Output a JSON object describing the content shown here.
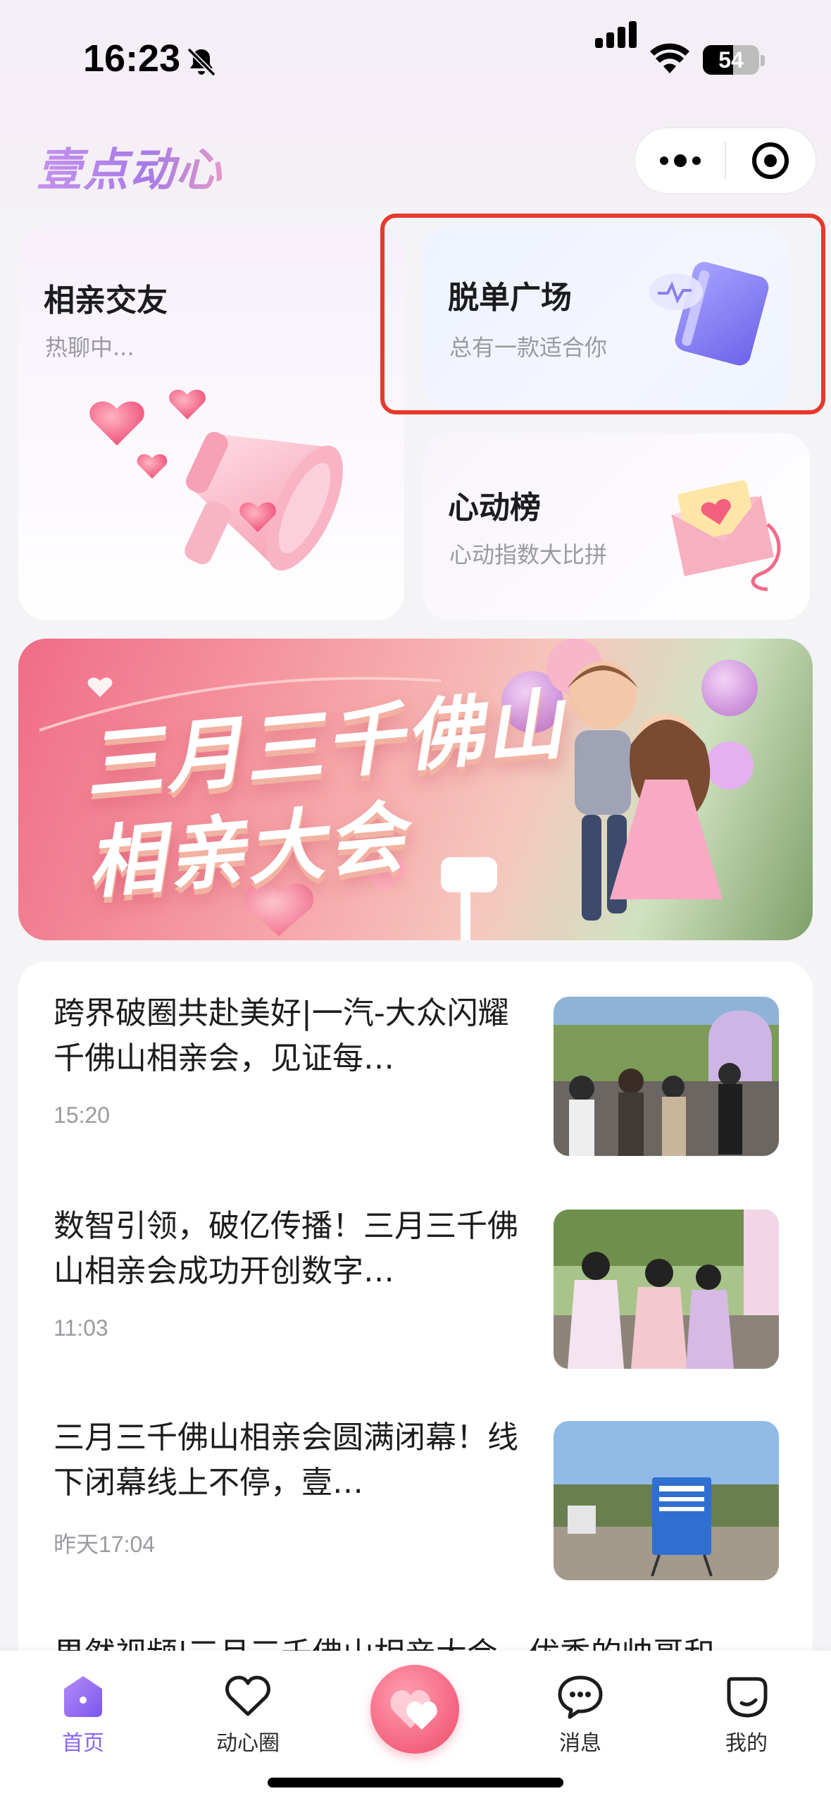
{
  "status_bar": {
    "time": "16:23",
    "battery": "54",
    "battery_level_percent": 54
  },
  "header": {
    "app_name": "壹点动心",
    "brand_colors": [
      "#c692ee",
      "#a67ae6",
      "#e199c8"
    ]
  },
  "features": {
    "dating": {
      "title": "相亲交友",
      "subtitle": "热聊中..."
    },
    "square": {
      "title": "脱单广场",
      "subtitle": "总有一款适合你"
    },
    "ranking": {
      "title": "心动榜",
      "subtitle": "心动指数大比拼"
    }
  },
  "annotation": {
    "highlight_color": "#e53a2c"
  },
  "banner": {
    "line1": "三月三千佛山",
    "line2": "相亲大会"
  },
  "news": [
    {
      "title": "跨界破圈共赴美好|一汽-大众闪耀千佛山相亲会，见证每…",
      "time": "15:20"
    },
    {
      "title": "数智引领，破亿传播！三月三千佛山相亲会成功开创数字…",
      "time": "11:03"
    },
    {
      "title": "三月三千佛山相亲会圆满闭幕！线下闭幕线上不停，壹…",
      "time": "昨天17:04"
    }
  ],
  "news_partial_title": "果然视频|三月三千佛山相亲大会，优秀的帅哥和",
  "tabbar": {
    "active_color": "#8a64f0",
    "items": [
      {
        "label": "首页",
        "icon": "home-icon"
      },
      {
        "label": "动心圈",
        "icon": "heart-icon"
      },
      {
        "label": "消息",
        "icon": "message-icon"
      },
      {
        "label": "我的",
        "icon": "profile-icon"
      }
    ],
    "center_icon": "double-heart-icon"
  }
}
